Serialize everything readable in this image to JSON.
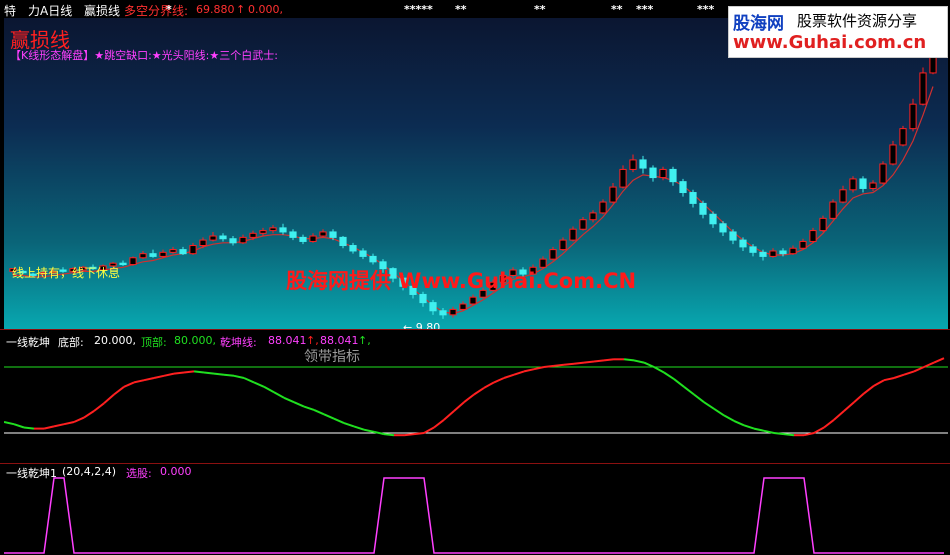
{
  "toolbar": {
    "items": [
      "特",
      "力A日线",
      "赢损线"
    ],
    "line_name": "多空分界线:",
    "line_value": "69.880",
    "line_arrow": "↑",
    "line_value2": "0.000,"
  },
  "top_markers": [
    {
      "text": "*"
    },
    {
      "text": "*****"
    },
    {
      "text": "**"
    },
    {
      "text": "**"
    },
    {
      "text": "**"
    },
    {
      "text": "***"
    },
    {
      "text": "***"
    }
  ],
  "main": {
    "title": "赢损线",
    "pattern_text": "【K线形态解盘】★跳空缺口:★光头阳线:★三个白武士:",
    "hold_text": "线上持有，线下休息",
    "watermark": "股海网提供 Www.Guhai.Com.CN",
    "low_label": "← 9.80"
  },
  "logo": {
    "cn": "股海网",
    "slogan": "股票软件资源分享",
    "url": "www.Guhai.com.cn"
  },
  "indicator1": {
    "name": "一线乾坤",
    "bottom_label": "底部:",
    "bottom_value": "20.000,",
    "top_label": "顶部:",
    "top_value": "80.000,",
    "line_label": "乾坤线:",
    "line_value": "88.041",
    "line_arrow": "↑,",
    "line_value2": "88.041",
    "line_arrow2": "↑,",
    "caption": "领带指标"
  },
  "indicator2": {
    "name": "一线乾坤1",
    "params": "(20,4,2,4)",
    "pick_label": "选股:",
    "pick_value": "0.000"
  },
  "colors": {
    "up": "#ff2020",
    "down": "#40f0f0",
    "white": "#ffffff",
    "green": "#20e020",
    "magenta": "#ff40ff",
    "yellow": "#ffff40",
    "red_line": "#d03030"
  },
  "chart_data": [
    {
      "type": "candlestick",
      "title": "赢损线",
      "price_min": 9.8,
      "series": [
        {
          "name": "candles",
          "values": [
            [
              13.3,
              13.5,
              13.5,
              13.1
            ],
            [
              13.3,
              13.2,
              13.4,
              13.1
            ],
            [
              13.1,
              13.0,
              13.2,
              12.9
            ],
            [
              13.1,
              13.2,
              13.3,
              13.0
            ],
            [
              13.2,
              13.3,
              13.5,
              13.1
            ],
            [
              13.4,
              13.3,
              13.6,
              13.2
            ],
            [
              13.3,
              13.5,
              13.6,
              13.2
            ],
            [
              13.4,
              13.6,
              13.7,
              13.3
            ],
            [
              13.6,
              13.5,
              13.8,
              13.4
            ],
            [
              13.4,
              13.7,
              13.8,
              13.3
            ],
            [
              13.7,
              13.9,
              14.0,
              13.6
            ],
            [
              13.9,
              13.8,
              14.1,
              13.7
            ],
            [
              13.8,
              14.3,
              14.4,
              13.7
            ],
            [
              14.3,
              14.6,
              14.8,
              14.2
            ],
            [
              14.6,
              14.4,
              14.9,
              14.3
            ],
            [
              14.4,
              14.7,
              14.9,
              14.3
            ],
            [
              14.7,
              14.9,
              15.1,
              14.6
            ],
            [
              14.9,
              14.6,
              15.1,
              14.5
            ],
            [
              14.6,
              15.2,
              15.4,
              14.5
            ],
            [
              15.2,
              15.6,
              15.8,
              15.0
            ],
            [
              15.6,
              15.9,
              16.2,
              15.5
            ],
            [
              15.9,
              15.7,
              16.1,
              15.5
            ],
            [
              15.7,
              15.4,
              15.9,
              15.2
            ],
            [
              15.4,
              15.8,
              16.0,
              15.3
            ],
            [
              15.8,
              16.1,
              16.3,
              15.6
            ],
            [
              16.1,
              16.3,
              16.5,
              15.9
            ],
            [
              16.3,
              16.5,
              16.7,
              16.1
            ],
            [
              16.5,
              16.2,
              16.8,
              16.0
            ],
            [
              16.2,
              15.8,
              16.4,
              15.6
            ],
            [
              15.8,
              15.5,
              16.0,
              15.3
            ],
            [
              15.5,
              15.9,
              16.1,
              15.4
            ],
            [
              15.9,
              16.2,
              16.4,
              15.8
            ],
            [
              16.2,
              15.8,
              16.4,
              15.6
            ],
            [
              15.8,
              15.2,
              15.9,
              15.0
            ],
            [
              15.2,
              14.8,
              15.4,
              14.6
            ],
            [
              14.8,
              14.4,
              15.0,
              14.2
            ],
            [
              14.4,
              14.0,
              14.6,
              13.8
            ],
            [
              14.0,
              13.5,
              14.2,
              13.2
            ],
            [
              13.5,
              12.8,
              13.6,
              12.5
            ],
            [
              12.8,
              12.2,
              13.0,
              11.9
            ],
            [
              12.2,
              11.6,
              12.4,
              11.3
            ],
            [
              11.6,
              11.0,
              11.8,
              10.7
            ],
            [
              11.0,
              10.4,
              11.2,
              10.1
            ],
            [
              10.4,
              10.1,
              10.6,
              9.8
            ],
            [
              10.1,
              10.5,
              10.7,
              9.9
            ],
            [
              10.5,
              10.9,
              11.1,
              10.4
            ],
            [
              10.9,
              11.4,
              11.6,
              10.8
            ],
            [
              11.4,
              11.9,
              12.1,
              11.3
            ],
            [
              11.9,
              12.5,
              12.7,
              11.8
            ],
            [
              12.5,
              13.0,
              13.2,
              12.4
            ],
            [
              13.0,
              13.4,
              13.6,
              12.8
            ],
            [
              13.4,
              13.1,
              13.6,
              12.9
            ],
            [
              13.1,
              13.6,
              13.8,
              13.0
            ],
            [
              13.6,
              14.2,
              14.4,
              13.5
            ],
            [
              14.2,
              14.9,
              15.1,
              14.1
            ],
            [
              14.9,
              15.6,
              15.8,
              14.8
            ],
            [
              15.6,
              16.4,
              16.6,
              15.5
            ],
            [
              16.4,
              17.1,
              17.3,
              16.3
            ],
            [
              17.1,
              17.6,
              17.8,
              16.9
            ],
            [
              17.6,
              18.4,
              18.6,
              17.5
            ],
            [
              18.4,
              19.5,
              19.8,
              18.3
            ],
            [
              19.5,
              20.8,
              21.1,
              19.4
            ],
            [
              20.8,
              21.5,
              21.9,
              20.6
            ],
            [
              21.5,
              20.9,
              21.8,
              20.5
            ],
            [
              20.9,
              20.2,
              21.1,
              19.9
            ],
            [
              20.2,
              20.8,
              21.0,
              20.0
            ],
            [
              20.8,
              19.9,
              21.0,
              19.6
            ],
            [
              19.9,
              19.1,
              20.1,
              18.8
            ],
            [
              19.1,
              18.3,
              19.3,
              18.0
            ],
            [
              18.3,
              17.5,
              18.5,
              17.2
            ],
            [
              17.5,
              16.8,
              17.7,
              16.5
            ],
            [
              16.8,
              16.2,
              17.0,
              15.9
            ],
            [
              16.2,
              15.6,
              16.4,
              15.3
            ],
            [
              15.6,
              15.1,
              15.8,
              14.8
            ],
            [
              15.1,
              14.7,
              15.3,
              14.4
            ],
            [
              14.7,
              14.4,
              14.9,
              14.1
            ],
            [
              14.4,
              14.8,
              15.0,
              14.3
            ],
            [
              14.8,
              14.6,
              15.0,
              14.4
            ],
            [
              14.6,
              15.0,
              15.2,
              14.5
            ],
            [
              15.0,
              15.5,
              15.7,
              14.9
            ],
            [
              15.5,
              16.3,
              16.5,
              15.4
            ],
            [
              16.3,
              17.2,
              17.4,
              16.2
            ],
            [
              17.2,
              18.4,
              18.6,
              17.1
            ],
            [
              18.4,
              19.3,
              19.6,
              18.3
            ],
            [
              19.3,
              20.1,
              20.3,
              19.1
            ],
            [
              20.1,
              19.4,
              20.3,
              19.1
            ],
            [
              19.4,
              19.8,
              20.0,
              19.2
            ],
            [
              19.8,
              21.2,
              21.4,
              19.7
            ],
            [
              21.2,
              22.6,
              22.9,
              21.1
            ],
            [
              22.6,
              23.8,
              24.0,
              22.5
            ],
            [
              23.8,
              25.6,
              26.0,
              23.6
            ],
            [
              25.6,
              27.9,
              28.3,
              25.5
            ],
            [
              27.9,
              30.6,
              31.2,
              27.8
            ]
          ]
        },
        {
          "name": "赢损线",
          "values": [
            13.0,
            13.0,
            12.9,
            12.9,
            13.0,
            13.1,
            13.2,
            13.3,
            13.3,
            13.4,
            13.5,
            13.6,
            13.8,
            14.0,
            14.1,
            14.3,
            14.5,
            14.6,
            14.8,
            15.1,
            15.3,
            15.4,
            15.4,
            15.5,
            15.7,
            15.9,
            16.0,
            16.0,
            15.9,
            15.7,
            15.7,
            15.8,
            15.7,
            15.4,
            15.1,
            14.7,
            14.3,
            13.8,
            13.2,
            12.6,
            12.0,
            11.4,
            10.8,
            10.3,
            10.2,
            10.4,
            10.8,
            11.2,
            11.7,
            12.2,
            12.7,
            12.9,
            13.1,
            13.5,
            14.0,
            14.6,
            15.3,
            16.0,
            16.6,
            17.3,
            18.2,
            19.2,
            20.0,
            20.4,
            20.3,
            20.2,
            20.0,
            19.6,
            19.0,
            18.3,
            17.6,
            16.9,
            16.2,
            15.6,
            15.1,
            14.7,
            14.5,
            14.5,
            14.6,
            14.9,
            15.4,
            16.1,
            17.0,
            17.9,
            18.7,
            19.0,
            19.1,
            19.6,
            20.4,
            21.5,
            22.9,
            24.8,
            26.9
          ]
        }
      ]
    },
    {
      "type": "line",
      "title": "一线乾坤",
      "ylim": [
        0,
        100
      ],
      "series": [
        {
          "name": "乾坤线",
          "values": [
            30,
            28,
            25,
            24,
            24,
            26,
            28,
            30,
            34,
            40,
            47,
            55,
            62,
            66,
            68,
            70,
            72,
            74,
            75,
            76,
            75,
            74,
            73,
            72,
            70,
            66,
            62,
            57,
            52,
            48,
            44,
            41,
            37,
            33,
            29,
            26,
            23,
            21,
            19,
            18,
            18,
            19,
            20,
            25,
            32,
            40,
            48,
            55,
            61,
            66,
            70,
            73,
            76,
            78,
            80,
            81,
            82,
            83,
            84,
            85,
            86,
            87,
            87,
            86,
            84,
            80,
            75,
            69,
            62,
            55,
            48,
            42,
            36,
            31,
            27,
            24,
            22,
            20,
            19,
            18,
            18,
            20,
            25,
            32,
            40,
            48,
            56,
            63,
            68,
            70,
            73,
            76,
            80,
            84,
            88
          ]
        }
      ]
    },
    {
      "type": "line",
      "title": "一线乾坤1",
      "series": [
        {
          "name": "选股",
          "values": [
            0,
            0,
            0,
            0,
            0,
            1,
            1,
            0,
            0,
            0,
            0,
            0,
            0,
            0,
            0,
            0,
            0,
            0,
            0,
            0,
            0,
            0,
            0,
            0,
            0,
            0,
            0,
            0,
            0,
            0,
            0,
            0,
            0,
            0,
            0,
            0,
            0,
            0,
            1,
            1,
            1,
            1,
            1,
            0,
            0,
            0,
            0,
            0,
            0,
            0,
            0,
            0,
            0,
            0,
            0,
            0,
            0,
            0,
            0,
            0,
            0,
            0,
            0,
            0,
            0,
            0,
            0,
            0,
            0,
            0,
            0,
            0,
            0,
            0,
            0,
            0,
            1,
            1,
            1,
            1,
            1,
            0,
            0,
            0,
            0,
            0,
            0,
            0,
            0,
            0,
            0,
            0,
            0,
            0,
            0
          ]
        }
      ]
    }
  ]
}
